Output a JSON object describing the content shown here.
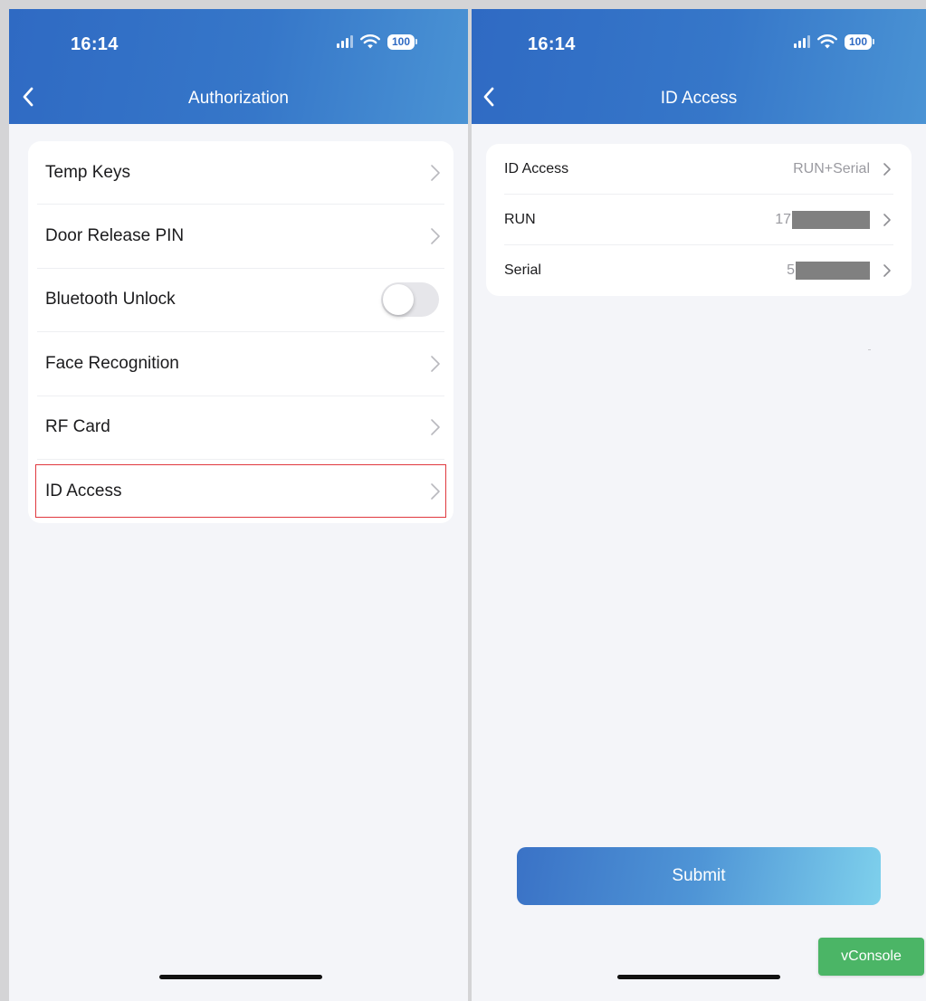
{
  "colors": {
    "header_gradient_start": "#2f6ac3",
    "header_gradient_end": "#4a93d4",
    "page_background": "#f4f5f9",
    "highlight_border": "#e0383e",
    "vconsole_green": "#4bb566"
  },
  "left_screen": {
    "status_bar": {
      "time": "16:14",
      "battery": "100"
    },
    "nav": {
      "title": "Authorization",
      "back_icon": "chevron-left-icon"
    },
    "menu_items": [
      {
        "label": "Temp Keys",
        "control": "chevron"
      },
      {
        "label": "Door Release PIN",
        "control": "chevron"
      },
      {
        "label": "Bluetooth Unlock",
        "control": "toggle",
        "toggle_on": false
      },
      {
        "label": "Face Recognition",
        "control": "chevron"
      },
      {
        "label": "RF Card",
        "control": "chevron"
      },
      {
        "label": "ID Access",
        "control": "chevron",
        "highlighted": true
      }
    ]
  },
  "right_screen": {
    "status_bar": {
      "time": "16:14",
      "battery": "100"
    },
    "nav": {
      "title": "ID Access",
      "back_icon": "chevron-left-icon"
    },
    "rows": [
      {
        "label": "ID Access",
        "value": "RUN+Serial"
      },
      {
        "label": "RUN",
        "value_prefix": "17",
        "redacted": true
      },
      {
        "label": "Serial",
        "value_prefix": "5",
        "redacted": true
      }
    ],
    "submit_label": "Submit"
  },
  "vconsole": {
    "label": "vConsole"
  }
}
